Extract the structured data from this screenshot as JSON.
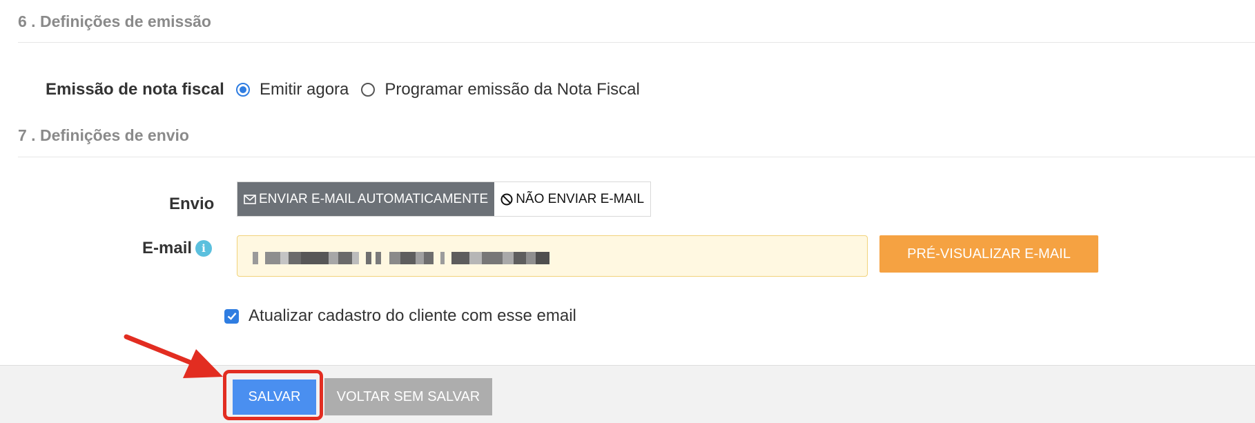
{
  "section6": {
    "title": "6 . Definições de emissão",
    "field_label": "Emissão de nota fiscal",
    "options": [
      {
        "label": "Emitir agora",
        "checked": true
      },
      {
        "label": "Programar emissão da Nota Fiscal",
        "checked": false
      }
    ]
  },
  "section7": {
    "title": "7 . Definições de envio",
    "envio_label": "Envio",
    "envio_options": [
      {
        "label": "ENVIAR E-MAIL AUTOMATICAMENTE",
        "icon": "envelope-icon",
        "active": true
      },
      {
        "label": "NÃO ENVIAR E-MAIL",
        "icon": "ban-icon",
        "active": false
      }
    ],
    "email_label": "E-mail",
    "email_value": "(redacted)",
    "preview_label": "PRÉ-VISUALIZAR E-MAIL",
    "update_checkbox_label": "Atualizar cadastro do cliente com esse email",
    "update_checked": true
  },
  "footer": {
    "save_label": "SALVAR",
    "back_label": "VOLTAR SEM SALVAR"
  },
  "colors": {
    "accent": "#2f7de1",
    "save_button": "#4a8ff0",
    "preview_button": "#f5a242",
    "highlight": "#e22d21",
    "active_toggle": "#6c7177"
  }
}
